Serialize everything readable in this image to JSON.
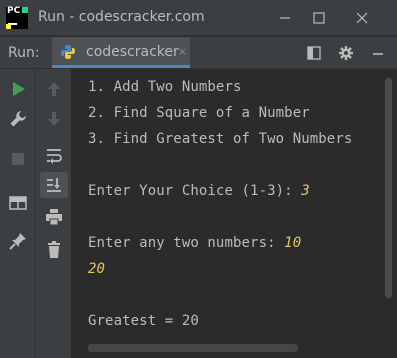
{
  "window": {
    "title": "Run - codescracker.com",
    "app_icon_text": "PC"
  },
  "run_panel": {
    "label": "Run:",
    "tab_label": "codescracker",
    "tab_close": "×"
  },
  "console": {
    "lines": [
      {
        "text": "1. Add Two Numbers",
        "input": ""
      },
      {
        "text": "2. Find Square of a Number",
        "input": ""
      },
      {
        "text": "3. Find Greatest of Two Numbers",
        "input": ""
      },
      {
        "text": "",
        "input": ""
      },
      {
        "text": "Enter Your Choice (1-3): ",
        "input": "3"
      },
      {
        "text": "",
        "input": ""
      },
      {
        "text": "Enter any two numbers: ",
        "input": "10"
      },
      {
        "text": "",
        "input": "20"
      },
      {
        "text": "",
        "input": ""
      },
      {
        "text": "Greatest = 20",
        "input": ""
      }
    ]
  },
  "colors": {
    "run_green": "#499c54",
    "input_yellow": "#e4c75a",
    "tab_accent": "#4a88c7"
  },
  "icons": {
    "titlebar": [
      "minimize-icon",
      "maximize-icon",
      "close-icon"
    ],
    "tabbar": [
      "layout-icon",
      "gear-icon",
      "minus-icon"
    ],
    "left_col1": [
      "run-icon",
      "wrench-icon",
      "stop-icon",
      "layout-icon",
      "pin-icon"
    ],
    "left_col2": [
      "arrow-up-icon",
      "arrow-down-icon",
      "soft-wrap-icon",
      "scroll-to-end-icon",
      "print-icon",
      "trash-icon"
    ]
  }
}
